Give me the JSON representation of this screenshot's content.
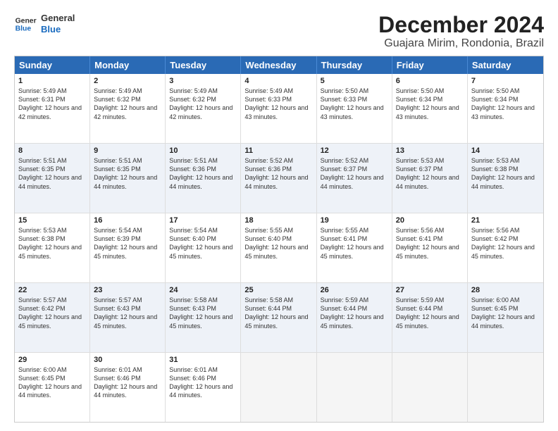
{
  "logo": {
    "line1": "General",
    "line2": "Blue"
  },
  "title": "December 2024",
  "subtitle": "Guajara Mirim, Rondonia, Brazil",
  "header_days": [
    "Sunday",
    "Monday",
    "Tuesday",
    "Wednesday",
    "Thursday",
    "Friday",
    "Saturday"
  ],
  "weeks": [
    [
      {
        "day": "1",
        "sunrise": "Sunrise: 5:49 AM",
        "sunset": "Sunset: 6:31 PM",
        "daylight": "Daylight: 12 hours and 42 minutes."
      },
      {
        "day": "2",
        "sunrise": "Sunrise: 5:49 AM",
        "sunset": "Sunset: 6:32 PM",
        "daylight": "Daylight: 12 hours and 42 minutes."
      },
      {
        "day": "3",
        "sunrise": "Sunrise: 5:49 AM",
        "sunset": "Sunset: 6:32 PM",
        "daylight": "Daylight: 12 hours and 42 minutes."
      },
      {
        "day": "4",
        "sunrise": "Sunrise: 5:49 AM",
        "sunset": "Sunset: 6:33 PM",
        "daylight": "Daylight: 12 hours and 43 minutes."
      },
      {
        "day": "5",
        "sunrise": "Sunrise: 5:50 AM",
        "sunset": "Sunset: 6:33 PM",
        "daylight": "Daylight: 12 hours and 43 minutes."
      },
      {
        "day": "6",
        "sunrise": "Sunrise: 5:50 AM",
        "sunset": "Sunset: 6:34 PM",
        "daylight": "Daylight: 12 hours and 43 minutes."
      },
      {
        "day": "7",
        "sunrise": "Sunrise: 5:50 AM",
        "sunset": "Sunset: 6:34 PM",
        "daylight": "Daylight: 12 hours and 43 minutes."
      }
    ],
    [
      {
        "day": "8",
        "sunrise": "Sunrise: 5:51 AM",
        "sunset": "Sunset: 6:35 PM",
        "daylight": "Daylight: 12 hours and 44 minutes."
      },
      {
        "day": "9",
        "sunrise": "Sunrise: 5:51 AM",
        "sunset": "Sunset: 6:35 PM",
        "daylight": "Daylight: 12 hours and 44 minutes."
      },
      {
        "day": "10",
        "sunrise": "Sunrise: 5:51 AM",
        "sunset": "Sunset: 6:36 PM",
        "daylight": "Daylight: 12 hours and 44 minutes."
      },
      {
        "day": "11",
        "sunrise": "Sunrise: 5:52 AM",
        "sunset": "Sunset: 6:36 PM",
        "daylight": "Daylight: 12 hours and 44 minutes."
      },
      {
        "day": "12",
        "sunrise": "Sunrise: 5:52 AM",
        "sunset": "Sunset: 6:37 PM",
        "daylight": "Daylight: 12 hours and 44 minutes."
      },
      {
        "day": "13",
        "sunrise": "Sunrise: 5:53 AM",
        "sunset": "Sunset: 6:37 PM",
        "daylight": "Daylight: 12 hours and 44 minutes."
      },
      {
        "day": "14",
        "sunrise": "Sunrise: 5:53 AM",
        "sunset": "Sunset: 6:38 PM",
        "daylight": "Daylight: 12 hours and 44 minutes."
      }
    ],
    [
      {
        "day": "15",
        "sunrise": "Sunrise: 5:53 AM",
        "sunset": "Sunset: 6:38 PM",
        "daylight": "Daylight: 12 hours and 45 minutes."
      },
      {
        "day": "16",
        "sunrise": "Sunrise: 5:54 AM",
        "sunset": "Sunset: 6:39 PM",
        "daylight": "Daylight: 12 hours and 45 minutes."
      },
      {
        "day": "17",
        "sunrise": "Sunrise: 5:54 AM",
        "sunset": "Sunset: 6:40 PM",
        "daylight": "Daylight: 12 hours and 45 minutes."
      },
      {
        "day": "18",
        "sunrise": "Sunrise: 5:55 AM",
        "sunset": "Sunset: 6:40 PM",
        "daylight": "Daylight: 12 hours and 45 minutes."
      },
      {
        "day": "19",
        "sunrise": "Sunrise: 5:55 AM",
        "sunset": "Sunset: 6:41 PM",
        "daylight": "Daylight: 12 hours and 45 minutes."
      },
      {
        "day": "20",
        "sunrise": "Sunrise: 5:56 AM",
        "sunset": "Sunset: 6:41 PM",
        "daylight": "Daylight: 12 hours and 45 minutes."
      },
      {
        "day": "21",
        "sunrise": "Sunrise: 5:56 AM",
        "sunset": "Sunset: 6:42 PM",
        "daylight": "Daylight: 12 hours and 45 minutes."
      }
    ],
    [
      {
        "day": "22",
        "sunrise": "Sunrise: 5:57 AM",
        "sunset": "Sunset: 6:42 PM",
        "daylight": "Daylight: 12 hours and 45 minutes."
      },
      {
        "day": "23",
        "sunrise": "Sunrise: 5:57 AM",
        "sunset": "Sunset: 6:43 PM",
        "daylight": "Daylight: 12 hours and 45 minutes."
      },
      {
        "day": "24",
        "sunrise": "Sunrise: 5:58 AM",
        "sunset": "Sunset: 6:43 PM",
        "daylight": "Daylight: 12 hours and 45 minutes."
      },
      {
        "day": "25",
        "sunrise": "Sunrise: 5:58 AM",
        "sunset": "Sunset: 6:44 PM",
        "daylight": "Daylight: 12 hours and 45 minutes."
      },
      {
        "day": "26",
        "sunrise": "Sunrise: 5:59 AM",
        "sunset": "Sunset: 6:44 PM",
        "daylight": "Daylight: 12 hours and 45 minutes."
      },
      {
        "day": "27",
        "sunrise": "Sunrise: 5:59 AM",
        "sunset": "Sunset: 6:44 PM",
        "daylight": "Daylight: 12 hours and 45 minutes."
      },
      {
        "day": "28",
        "sunrise": "Sunrise: 6:00 AM",
        "sunset": "Sunset: 6:45 PM",
        "daylight": "Daylight: 12 hours and 44 minutes."
      }
    ],
    [
      {
        "day": "29",
        "sunrise": "Sunrise: 6:00 AM",
        "sunset": "Sunset: 6:45 PM",
        "daylight": "Daylight: 12 hours and 44 minutes."
      },
      {
        "day": "30",
        "sunrise": "Sunrise: 6:01 AM",
        "sunset": "Sunset: 6:46 PM",
        "daylight": "Daylight: 12 hours and 44 minutes."
      },
      {
        "day": "31",
        "sunrise": "Sunrise: 6:01 AM",
        "sunset": "Sunset: 6:46 PM",
        "daylight": "Daylight: 12 hours and 44 minutes."
      },
      {
        "day": "",
        "sunrise": "",
        "sunset": "",
        "daylight": ""
      },
      {
        "day": "",
        "sunrise": "",
        "sunset": "",
        "daylight": ""
      },
      {
        "day": "",
        "sunrise": "",
        "sunset": "",
        "daylight": ""
      },
      {
        "day": "",
        "sunrise": "",
        "sunset": "",
        "daylight": ""
      }
    ]
  ]
}
